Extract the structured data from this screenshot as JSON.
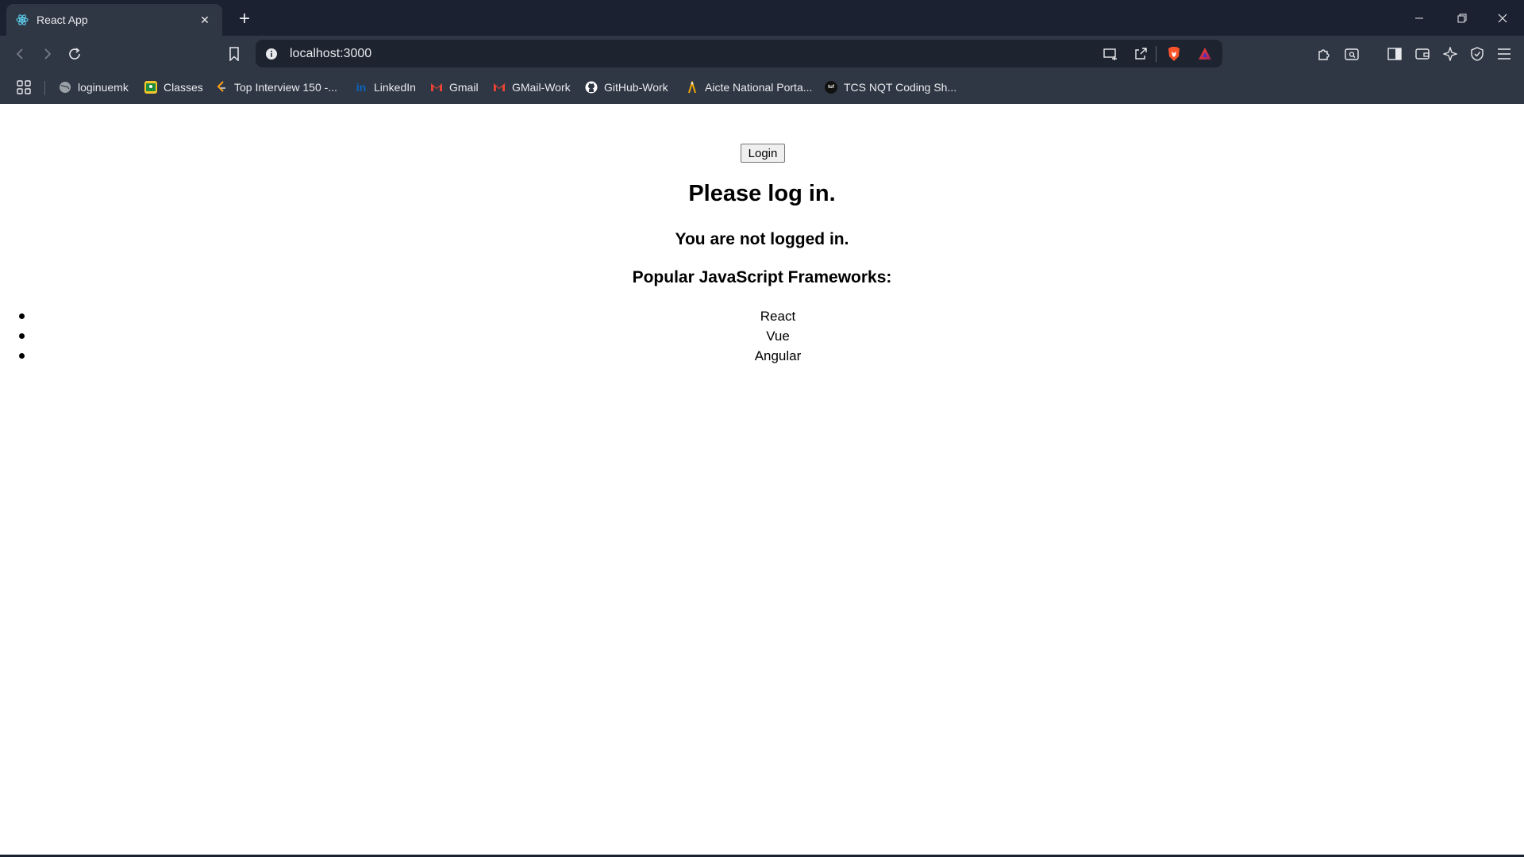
{
  "browser": {
    "tab": {
      "title": "React App",
      "favicon": "react-logo-icon",
      "close_glyph": "✕"
    },
    "newtab_glyph": "+",
    "address_bar": {
      "url": "localhost:3000"
    },
    "bookmarks": [
      {
        "label": "loginuemk",
        "icon": "globe-icon",
        "color": "#9aa0a6"
      },
      {
        "label": "Classes",
        "icon": "classroom-icon",
        "color": "#f7c72a"
      },
      {
        "label": "Top Interview 150 -...",
        "icon": "leetcode-icon",
        "color": "#ffa116"
      },
      {
        "label": "LinkedIn",
        "icon": "linkedin-icon",
        "color": "#0a66c2"
      },
      {
        "label": "Gmail",
        "icon": "gmail-icon",
        "color": "#ea4335"
      },
      {
        "label": "GMail-Work",
        "icon": "gmail-icon",
        "color": "#ea4335"
      },
      {
        "label": "GitHub-Work",
        "icon": "github-icon",
        "color": "#ffffff"
      },
      {
        "label": "Aicte National Porta...",
        "icon": "aicte-icon",
        "color": "#f2a900"
      },
      {
        "label": "TCS NQT Coding Sh...",
        "icon": "tuf-icon",
        "color": "#111111"
      }
    ]
  },
  "page": {
    "login_button": "Login",
    "heading": "Please log in.",
    "status": "You are not logged in.",
    "frameworks_heading": "Popular JavaScript Frameworks:",
    "frameworks": [
      "React",
      "Vue",
      "Angular"
    ]
  },
  "colors": {
    "tabstrip_bg": "#1b2131",
    "toolbar_bg": "#303744",
    "omnibox_bg": "#1e2330",
    "brave_orange": "#fb542b"
  }
}
